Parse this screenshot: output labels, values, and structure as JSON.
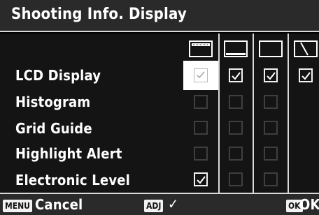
{
  "title": "Shooting Info. Display",
  "rows": [
    {
      "label": "LCD Display"
    },
    {
      "label": "Histogram"
    },
    {
      "label": "Grid Guide"
    },
    {
      "label": "Highlight Alert"
    },
    {
      "label": "Electronic Level"
    }
  ],
  "column_icons": [
    "display-mode-1-icon",
    "display-mode-2-icon",
    "display-mode-3-icon",
    "display-mode-4-icon"
  ],
  "checkbox_states": [
    [
      true,
      true,
      true,
      true
    ],
    [
      false,
      false,
      false
    ],
    [
      false,
      false,
      false
    ],
    [
      false,
      false,
      false
    ],
    [
      true,
      false,
      false
    ]
  ],
  "footer": {
    "menu_badge": "MENU",
    "cancel_label": "Cancel",
    "adj_badge": "ADJ",
    "adj_symbol": "✓",
    "ok_badge": "OK",
    "ok_label": "OK"
  },
  "colors": {
    "title_bg": "#2a2a2a",
    "panel_bg": "#141414",
    "separator": "#d9d9d9",
    "checkbox_on": "#f2f2f2",
    "checkbox_off": "#3f3f3f",
    "selection": "#ffffff"
  }
}
